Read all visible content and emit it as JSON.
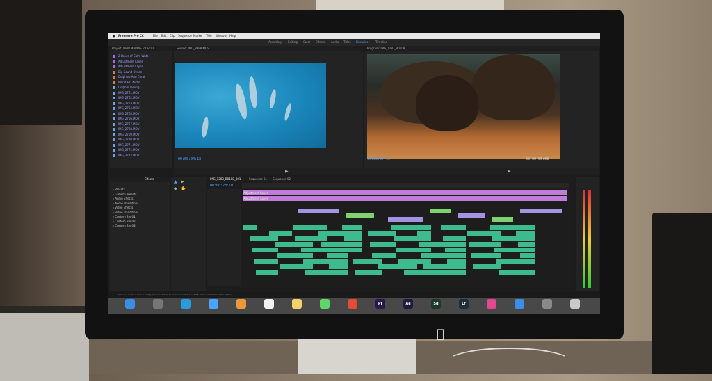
{
  "menubar": {
    "app_name": "Premiere Pro CC",
    "items": [
      "File",
      "Edit",
      "Clip",
      "Sequence",
      "Marker",
      "Title",
      "Window",
      "Help"
    ]
  },
  "workspaces": [
    "Assembly",
    "Editing",
    "Color",
    "Effects",
    "Audio",
    "Titles",
    "Libraries",
    "Timeline"
  ],
  "project_panel": {
    "title": "Project: NEW MARINE VIDEO 2",
    "rows": [
      {
        "name": "2 Hours of Calm Water",
        "color": "#a56be0"
      },
      {
        "name": "Adjustment Layer",
        "color": "#a56be0"
      },
      {
        "name": "Adjustment Layer",
        "color": "#a56be0"
      },
      {
        "name": "Big Sound Ocean",
        "color": "#e07c3b"
      },
      {
        "name": "Dolphins And Coral",
        "color": "#e07c3b"
      },
      {
        "name": "World HD Audio",
        "color": "#e07c3b"
      },
      {
        "name": "Dolphin Talking",
        "color": "#6aa6e8"
      },
      {
        "name": "IMG_2761.MOV",
        "color": "#6aa6e8"
      },
      {
        "name": "IMG_2762.MOV",
        "color": "#6aa6e8"
      },
      {
        "name": "IMG_2763.MOV",
        "color": "#6aa6e8"
      },
      {
        "name": "IMG_2764.MOV",
        "color": "#6aa6e8"
      },
      {
        "name": "IMG_2765.MOV",
        "color": "#6aa6e8"
      },
      {
        "name": "IMG_2766.MOV",
        "color": "#6aa6e8"
      },
      {
        "name": "IMG_2767.MOV",
        "color": "#6aa6e8"
      },
      {
        "name": "IMG_2768.MOV",
        "color": "#6aa6e8"
      },
      {
        "name": "IMG_2769.MOV",
        "color": "#6aa6e8"
      },
      {
        "name": "IMG_2770.MOV",
        "color": "#6aa6e8"
      },
      {
        "name": "IMG_2771.MOV",
        "color": "#6aa6e8"
      },
      {
        "name": "IMG_2772.MOV",
        "color": "#6aa6e8"
      },
      {
        "name": "IMG_2773.MOV",
        "color": "#6aa6e8"
      }
    ]
  },
  "source_monitor": {
    "tab": "Source: IMG_3998.MOV",
    "timecode": "00:00:04:18"
  },
  "program_monitor": {
    "tab": "Program: IMG_1283_B0108",
    "timecode": "00:00:07:15",
    "end_timecode": "00:00:05:08"
  },
  "effects_panel": {
    "tab": "Effects",
    "items": [
      "Presets",
      "Lumetri Presets",
      "Audio Effects",
      "Audio Transitions",
      "Video Effects",
      "Video Transitions",
      "Custom Bin 01",
      "Custom Bin 02",
      "Custom Bin 03"
    ]
  },
  "timeline": {
    "tabs": [
      "IMG_1283_B0108_001",
      "Sequence 01",
      "Sequence 02"
    ],
    "timecode": "00:00:28:10",
    "clip_label": "Adjustment Layer"
  },
  "status_bar": {
    "text": "Click to select, or click in empty space and drag to marquee select. Use Shift, Opt, and Cmd for other options."
  },
  "dock": {
    "apps": [
      {
        "name": "finder-icon",
        "color": "#3a8ee6",
        "label": ""
      },
      {
        "name": "launchpad-icon",
        "color": "#777",
        "label": ""
      },
      {
        "name": "safari-icon",
        "color": "#2a9bde",
        "label": ""
      },
      {
        "name": "mail-icon",
        "color": "#4aa3ff",
        "label": ""
      },
      {
        "name": "photos-icon",
        "color": "#e89a3b",
        "label": ""
      },
      {
        "name": "calendar-icon",
        "color": "#f2f2f2",
        "label": ""
      },
      {
        "name": "notes-icon",
        "color": "#f3d36b",
        "label": ""
      },
      {
        "name": "messages-icon",
        "color": "#5ed66a",
        "label": ""
      },
      {
        "name": "chrome-icon",
        "color": "#e54b3b",
        "label": ""
      },
      {
        "name": "premiere-icon",
        "color": "#2a1a4a",
        "label": "Pr"
      },
      {
        "name": "after-effects-icon",
        "color": "#1f1a3a",
        "label": "Ae"
      },
      {
        "name": "speedgrade-icon",
        "color": "#1b3a2c",
        "label": "Sg"
      },
      {
        "name": "lightroom-icon",
        "color": "#1b2e3a",
        "label": "Lr"
      },
      {
        "name": "itunes-icon",
        "color": "#e34a8e",
        "label": ""
      },
      {
        "name": "appstore-icon",
        "color": "#3a8ee6",
        "label": ""
      },
      {
        "name": "settings-icon",
        "color": "#8a8a8a",
        "label": ""
      },
      {
        "name": "trash-icon",
        "color": "#c9c9c9",
        "label": ""
      }
    ]
  },
  "colors": {
    "accent_blue": "#4aa3ff",
    "clip_green": "#3dbb8f",
    "clip_purple": "#c07cd8"
  }
}
